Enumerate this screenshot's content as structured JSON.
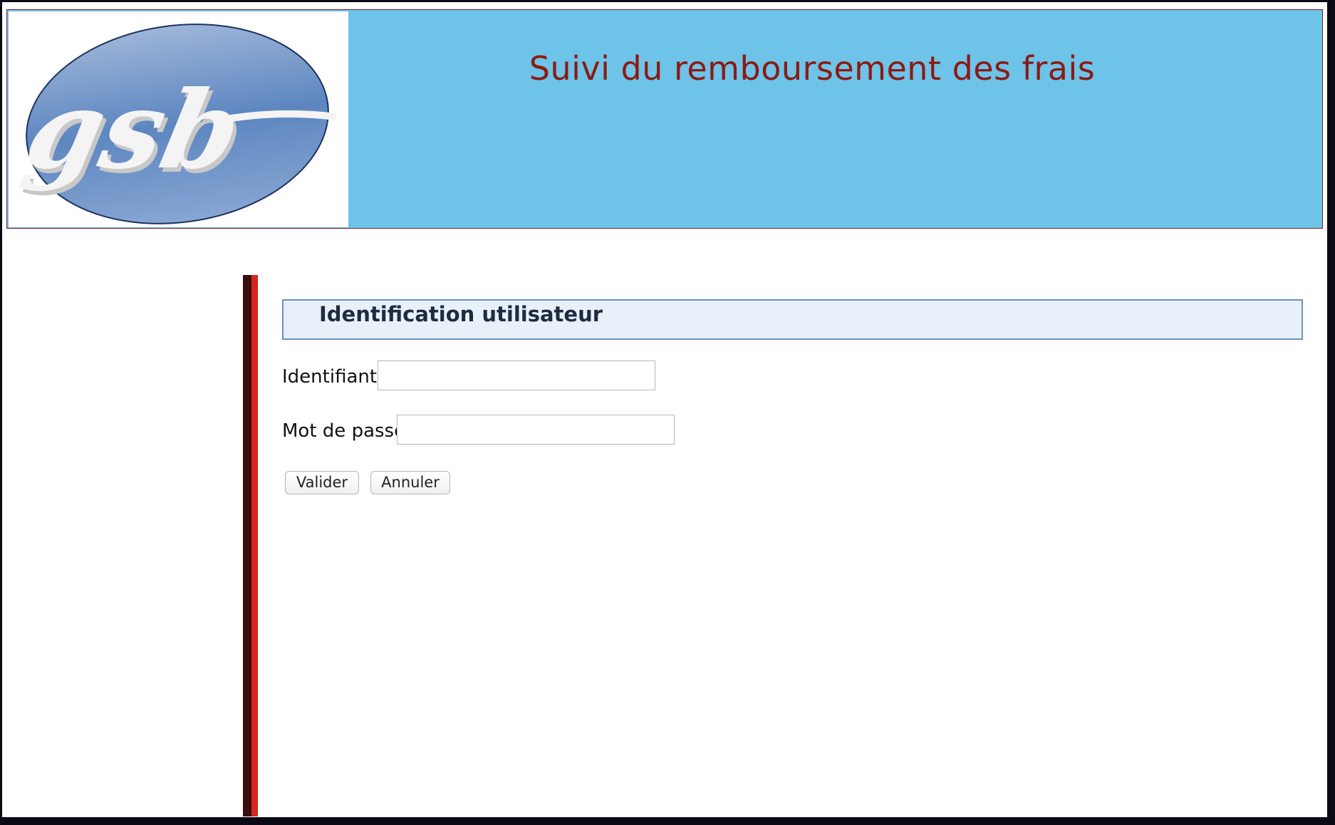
{
  "header": {
    "logo_text": "gsb",
    "title": "Suivi du remboursement des frais"
  },
  "login_panel": {
    "title": "Identification utilisateur",
    "username_label": "Identifiant",
    "username_value": "",
    "password_label": "Mot de passe",
    "password_value": "",
    "submit_label": "Valider",
    "cancel_label": "Annuler"
  },
  "colors": {
    "header_background": "#6ec3e8",
    "title_color": "#8b1a12",
    "panel_background": "#e8f0fa",
    "sidebar_accent": "#d8261c"
  }
}
